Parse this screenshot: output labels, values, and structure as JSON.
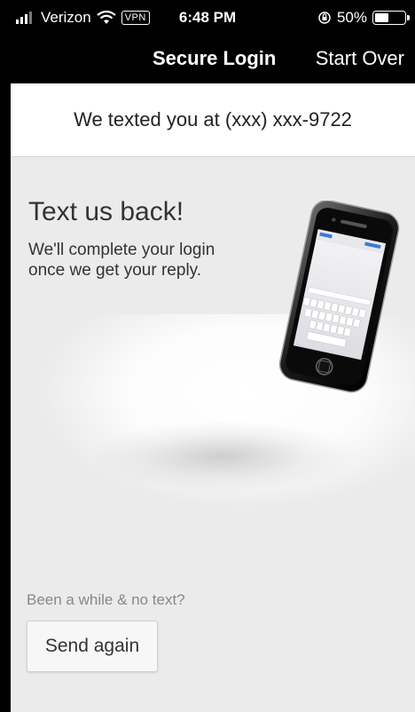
{
  "status_bar": {
    "carrier": "Verizon",
    "vpn_label": "VPN",
    "time": "6:48 PM",
    "battery": "50%",
    "battery_level": 0.5
  },
  "nav": {
    "title": "Secure Login",
    "start_over": "Start Over"
  },
  "banner": {
    "text": "We texted you at (xxx) xxx-9722"
  },
  "main": {
    "headline": "Text us back!",
    "description": "We'll complete your login once we get your reply.",
    "hint": "Been a while & no text?",
    "send_again_label": "Send again"
  },
  "colors": {
    "background": "#ecebec",
    "bar": "#000000",
    "text": "#333333",
    "hint": "#888888"
  }
}
